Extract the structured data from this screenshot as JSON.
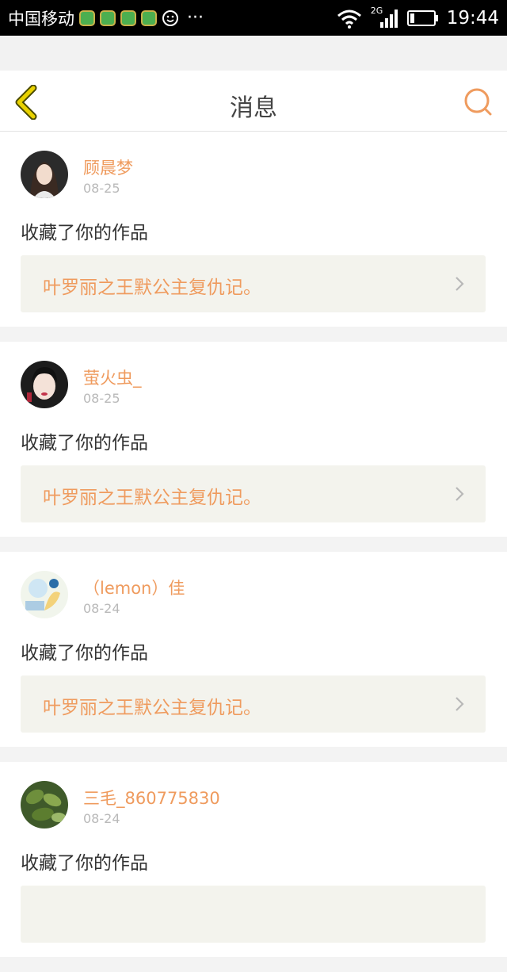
{
  "status_bar": {
    "carrier": "中国移动",
    "network": "2G",
    "time": "19:44",
    "more": "···"
  },
  "header": {
    "title": "消息"
  },
  "colors": {
    "accent": "#ef9b5e",
    "back_icon": "#e9d200"
  },
  "messages": [
    {
      "username": "顾晨梦",
      "date": "08-25",
      "action": "收藏了你的作品",
      "work_title": "叶罗丽之王默公主复仇记。"
    },
    {
      "username": "萤火虫_",
      "date": "08-25",
      "action": "收藏了你的作品",
      "work_title": "叶罗丽之王默公主复仇记。"
    },
    {
      "username": "（lemon）佳",
      "date": "08-24",
      "action": "收藏了你的作品",
      "work_title": "叶罗丽之王默公主复仇记。"
    },
    {
      "username": "三毛_860775830",
      "date": "08-24",
      "action": "收藏了你的作品",
      "work_title": ""
    }
  ]
}
